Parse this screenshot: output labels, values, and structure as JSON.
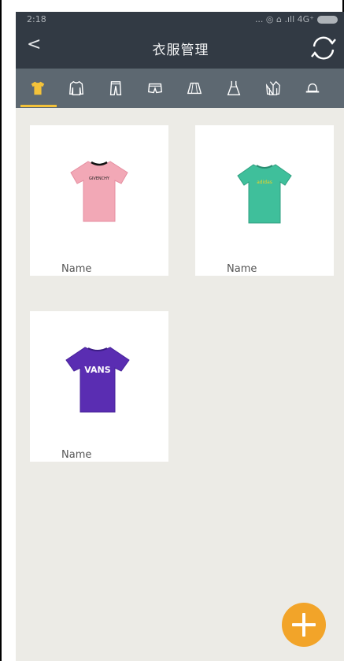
{
  "status_bar": {
    "time": "2:18",
    "indicators": "... ◎ ⌂ .ıll 4G⁺"
  },
  "header": {
    "back_symbol": "<",
    "title": "衣服管理",
    "refresh_icon": "refresh-icon"
  },
  "tabs": [
    {
      "id": "tshirt",
      "icon": "tshirt-icon",
      "active": true
    },
    {
      "id": "sweater",
      "icon": "sweater-icon",
      "active": false
    },
    {
      "id": "pants",
      "icon": "pants-icon",
      "active": false
    },
    {
      "id": "shorts",
      "icon": "shorts-icon",
      "active": false
    },
    {
      "id": "skirt",
      "icon": "skirt-icon",
      "active": false
    },
    {
      "id": "dress",
      "icon": "dress-icon",
      "active": false
    },
    {
      "id": "coat",
      "icon": "coat-icon",
      "active": false
    },
    {
      "id": "hat",
      "icon": "hat-icon",
      "active": false
    }
  ],
  "items": [
    {
      "label": "Name",
      "shirt_color": "#f2a8b6",
      "print": "GIVENCHY"
    },
    {
      "label": "Name",
      "shirt_color": "#3fbf9b",
      "print": "adidas"
    },
    {
      "label": "Name",
      "shirt_color": "#5a2db2",
      "print": "VANS"
    }
  ],
  "fab": {
    "icon": "plus-icon"
  },
  "colors": {
    "header_bg": "#323a44",
    "tabbar_bg": "#5d6871",
    "accent": "#f3c23a",
    "fab": "#f2a429",
    "screen_bg": "#ecebe6"
  }
}
